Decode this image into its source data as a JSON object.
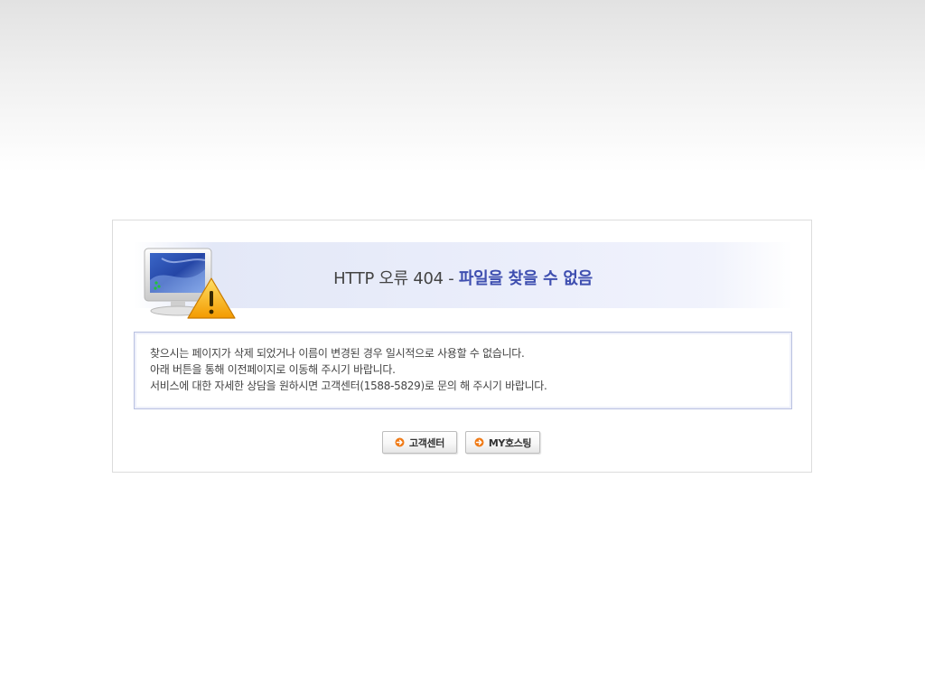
{
  "error": {
    "title_code": "HTTP 오류 404 - ",
    "title_desc": "파일을 찾을 수 없음",
    "icon": "monitor-warning-icon"
  },
  "message": {
    "lines": [
      "찾으시는 페이지가 삭제 되었거나 이름이 변경된 경우 일시적으로 사용할 수 없습니다.",
      "아래 버튼을 통해 이전페이지로 이동해 주시기 바랍니다.",
      "서비스에 대한 자세한 상담을 원하시면 고객센터(1588-5829)로 문의 해 주시기 바랍니다."
    ]
  },
  "buttons": {
    "customer_center": "고객센터",
    "my_hosting": "MY호스팅",
    "icon": "orange-arrow-icon"
  },
  "colors": {
    "accent": "#3f4fb0",
    "button_icon": "#f07a16",
    "warning": "#f5a000"
  }
}
